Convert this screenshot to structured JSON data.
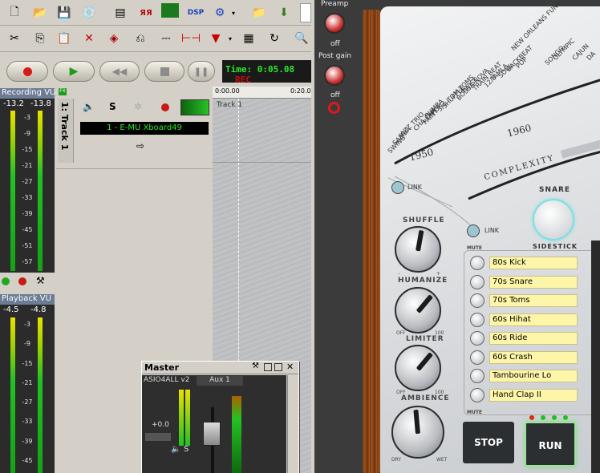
{
  "toolbar1": {
    "icons": [
      "new-icon",
      "open-icon",
      "save-icon",
      "cd-icon",
      "track-view-icon",
      "pianoroll-icon",
      "waveform-icon",
      "dsp-icon",
      "fx-icon",
      "folder-icon",
      "export-icon"
    ]
  },
  "toolbar2": {
    "icons": [
      "cut-icon",
      "copy-icon",
      "paste-icon",
      "delete-icon",
      "select-icon",
      "link-icon",
      "snap-icon",
      "range-icon",
      "marker-icon",
      "grid-icon",
      "loop-icon",
      "zoom-icon"
    ]
  },
  "transport": {
    "time": "Time: 0:05.08",
    "rec_label": "REC"
  },
  "recording_vu": {
    "title": "Recording VU",
    "peak_left": "-13.2",
    "peak_right": "-13.8",
    "scale": [
      "-3",
      "-9",
      "-15",
      "-21",
      "-27",
      "-33",
      "-39",
      "-45",
      "-51",
      "-57"
    ]
  },
  "playback_vu": {
    "title": "Playback VU",
    "peak_left": "-4.5",
    "peak_right": "-4.8",
    "scale": [
      "-3",
      "-9",
      "-15",
      "-21",
      "-27",
      "-33",
      "-39",
      "-45"
    ]
  },
  "track": {
    "number_label": "1: Track 1",
    "input": "1 - E-MU Xboard49",
    "clip_name": "Track 1"
  },
  "timeline": {
    "start": "0:00.00",
    "next": "0:20.0"
  },
  "master": {
    "title": "Master",
    "driver": "ASIO4ALL v2",
    "aux": "Aux 1",
    "volume": "+0.0"
  },
  "plugin": {
    "preamp_label": "Preamp",
    "preamp_state": "off",
    "postgain_label": "Post gain",
    "postgain_state": "off",
    "decades": [
      "1950",
      "1960"
    ],
    "styles": [
      "SWING",
      "SAMBA",
      "JAZZ TRIO",
      "CHA CHA",
      "PAINT",
      "RUMBA",
      "FOX",
      "3/4",
      "SHUFFLE",
      "TOM-TOMS",
      "BOSSA NOVA",
      "TWIST",
      "TRAIN BEAT",
      "12/8",
      "TAMLA",
      "SOUL",
      "BACKBEAT",
      "POP",
      "NEW ORLEANS FUNK",
      "SONGO",
      "OLYMPIC",
      "CAJUN",
      "DA"
    ],
    "complexity_label": "COMPLEXITY",
    "link_label": "LINK",
    "knobs": {
      "shuffle": "SHUFFLE",
      "humanize": "HUMANIZE",
      "limiter": "LIMITER",
      "ambience": "AMBIENCE",
      "off": "OFF",
      "hundred": "100",
      "dry": "DRY",
      "wet": "WET",
      "minus": "-",
      "plus": "+"
    },
    "snare": {
      "label": "SNARE",
      "sub": "SIDESTICK"
    },
    "mute_label": "MUTE",
    "instruments": [
      "80s Kick",
      "70s Snare",
      "70s Toms",
      "60s Hihat",
      "60s Ride",
      "60s Crash",
      "Tambourine Lo",
      "Hand Clap II"
    ],
    "stop": "STOP",
    "run": "RUN"
  },
  "colors": {
    "accent_green": "#2ee82e",
    "record_red": "#d81a1a",
    "panel_silver": "#dfe1e3"
  }
}
